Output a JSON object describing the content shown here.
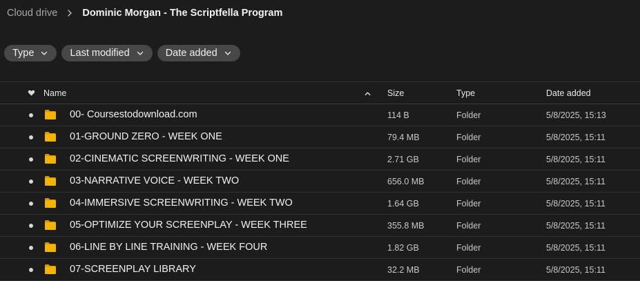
{
  "breadcrumb": {
    "root": "Cloud drive",
    "current": "Dominic Morgan - The Scriptfella Program"
  },
  "filters": [
    {
      "label": "Type",
      "icon": "chevron-down-icon"
    },
    {
      "label": "Last modified",
      "icon": "chevron-down-icon"
    },
    {
      "label": "Date added",
      "icon": "chevron-down-icon"
    }
  ],
  "table": {
    "headers": {
      "favorite_icon": "heart-icon",
      "name": "Name",
      "sort_icon": "chevron-up-icon",
      "size": "Size",
      "type": "Type",
      "date_added": "Date added"
    },
    "rows": [
      {
        "name": "00- Coursestodownload.com",
        "size": "114 B",
        "type": "Folder",
        "date": "5/8/2025, 15:13"
      },
      {
        "name": "01-GROUND ZERO - WEEK ONE",
        "size": "79.4 MB",
        "type": "Folder",
        "date": "5/8/2025, 15:11"
      },
      {
        "name": "02-CINEMATIC SCREENWRITING - WEEK ONE",
        "size": "2.71 GB",
        "type": "Folder",
        "date": "5/8/2025, 15:11"
      },
      {
        "name": "03-NARRATIVE VOICE - WEEK TWO",
        "size": "656.0 MB",
        "type": "Folder",
        "date": "5/8/2025, 15:11"
      },
      {
        "name": "04-IMMERSIVE SCREENWRITING - WEEK TWO",
        "size": "1.64 GB",
        "type": "Folder",
        "date": "5/8/2025, 15:11"
      },
      {
        "name": "05-OPTIMIZE YOUR SCREENPLAY - WEEK THREE",
        "size": "355.8 MB",
        "type": "Folder",
        "date": "5/8/2025, 15:11"
      },
      {
        "name": "06-LINE BY LINE TRAINING - WEEK FOUR",
        "size": "1.82 GB",
        "type": "Folder",
        "date": "5/8/2025, 15:11"
      },
      {
        "name": "07-SCREENPLAY LIBRARY",
        "size": "32.2 MB",
        "type": "Folder",
        "date": "5/8/2025, 15:11"
      }
    ]
  },
  "colors": {
    "background": "#1c1c1c",
    "chip": "#474747",
    "folder": "#f5b400",
    "folder_tab": "#d99a00"
  }
}
